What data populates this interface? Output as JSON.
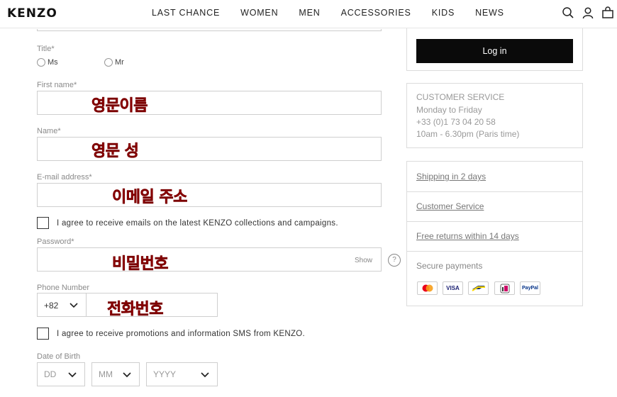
{
  "header": {
    "logo": "KENZO",
    "nav": [
      "LAST CHANCE",
      "WOMEN",
      "MEN",
      "ACCESSORIES",
      "KIDS",
      "NEWS"
    ]
  },
  "form": {
    "title_label": "Title*",
    "title_options": [
      "Ms",
      "Mr"
    ],
    "first_name_label": "First name*",
    "first_name_annotation": "영문이름",
    "name_label": "Name*",
    "name_annotation": "영문 성",
    "email_label": "E-mail address*",
    "email_annotation": "이메일 주소",
    "email_consent": "I agree to receive emails on the latest KENZO collections and campaigns.",
    "password_label": "Password*",
    "password_annotation": "비밀번호",
    "password_show": "Show",
    "phone_label": "Phone Number",
    "phone_code": "+82",
    "phone_annotation": "전화번호",
    "sms_consent": "I agree to receive promotions and information SMS from KENZO.",
    "dob_label": "Date of Birth",
    "dob_day": "DD",
    "dob_month": "MM",
    "dob_year": "YYYY"
  },
  "sidebar": {
    "login_button": "Log in",
    "customer_service_title": "CUSTOMER SERVICE",
    "cs_hours": "Monday to Friday",
    "cs_phone": "+33 (0)1 73 04 20 58",
    "cs_time": "10am - 6.30pm (Paris time)",
    "links": [
      "Shipping in 2 days",
      "Customer Service",
      "Free returns within 14 days"
    ],
    "secure_payments": "Secure payments",
    "payment_methods": [
      "mastercard-icon",
      "VISA",
      "bancontact-icon",
      "ideal-icon",
      "PayPal"
    ]
  },
  "colors": {
    "annotation_red": "#c0000b",
    "button_black": "#0a0a0a"
  }
}
